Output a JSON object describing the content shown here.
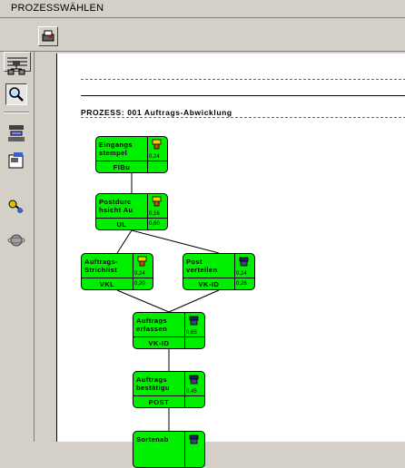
{
  "window": {
    "title": "PROZESSWÄHLEN"
  },
  "toolbar": {
    "buttons": [
      {
        "icon": "print-icon"
      }
    ]
  },
  "sidebar": {
    "items": [
      {
        "icon": "menu-lines-icon"
      },
      {
        "icon": "hierarchy-icon"
      },
      {
        "icon": "magnifier-icon",
        "active": true
      },
      {
        "icon": "network-icon"
      },
      {
        "icon": "document-edit-icon"
      },
      {
        "icon": "key-icon"
      },
      {
        "icon": "globe-icon"
      }
    ]
  },
  "canvas": {
    "process_title": "PROZESS: 001 Auftrags-Abwicklung",
    "nodes": [
      {
        "name": "Eingangs\nstempel",
        "code": "FIBu",
        "value1": "0,24",
        "value2": "",
        "icon": "person-yellow-icon"
      },
      {
        "name": "Postdurc\nhsicht Au",
        "code": "UL",
        "value1": "0,16",
        "value2": "0,60",
        "icon": "person-yellow-icon"
      },
      {
        "name": "Auftrags-\nStrichlist",
        "code": "VKL",
        "value1": "0,24",
        "value2": "0,20",
        "icon": "person-yellow-icon"
      },
      {
        "name": "Post\nverteilen",
        "code": "VK-ID",
        "value1": "0,24",
        "value2": "0,26",
        "icon": "telephone-icon"
      },
      {
        "name": "Auftrags\nerfassen",
        "code": "VK-ID",
        "value1": "0,65",
        "value2": "",
        "icon": "telephone-icon"
      },
      {
        "name": "Auftrags\nbestätigu",
        "code": "POST",
        "value1": "0,45",
        "value2": "",
        "icon": "telephone-icon"
      },
      {
        "name": "Sortenab",
        "code": "",
        "value1": "",
        "value2": "",
        "icon": "telephone-icon"
      }
    ]
  },
  "colors": {
    "node_fill": "#00ee00",
    "guide_line": "#00b000",
    "chrome": "#d4d0c8"
  }
}
